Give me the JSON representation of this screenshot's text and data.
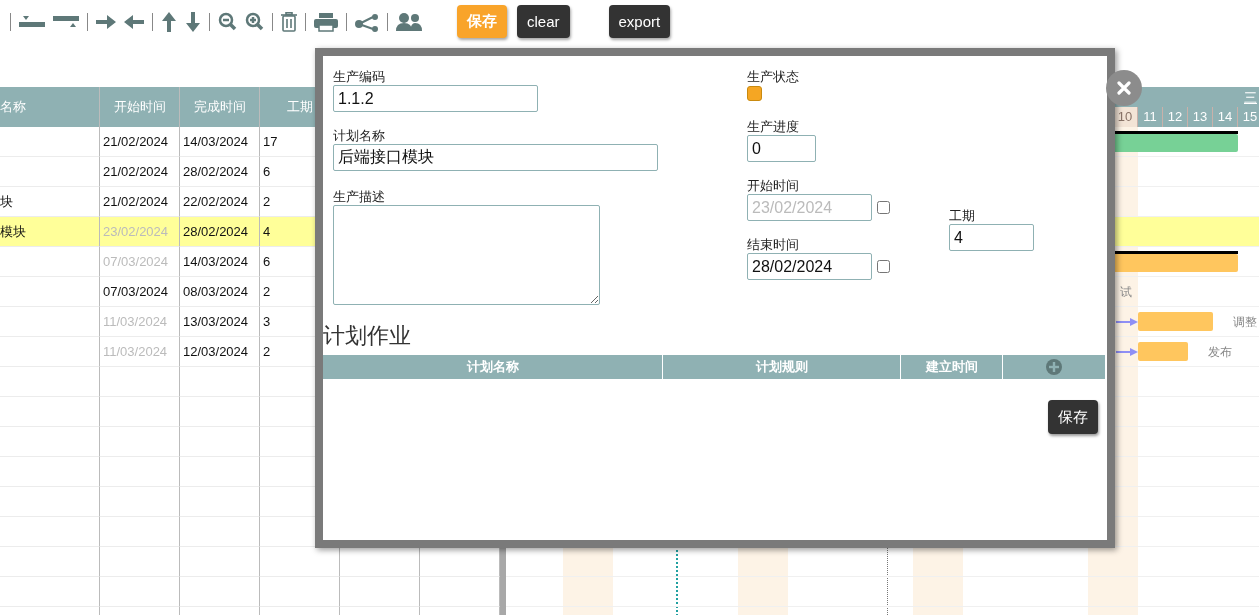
{
  "toolbar": {
    "buttons": [
      {
        "label": "保存",
        "kind": "primary"
      },
      {
        "label": "clear",
        "kind": "dark"
      },
      {
        "label": "export",
        "kind": "dark"
      }
    ]
  },
  "task_table": {
    "columns": [
      "名称",
      "开始时间",
      "完成时间",
      "工期"
    ],
    "rows": [
      {
        "start": "21/02/2024",
        "end": "14/03/2024",
        "duration": "17",
        "start_disabled": false,
        "selected": false,
        "bar": {
          "kind": "summary",
          "color": "#77d196"
        }
      },
      {
        "start": "21/02/2024",
        "end": "28/02/2024",
        "duration": "6",
        "start_disabled": false,
        "selected": false
      },
      {
        "name": "块",
        "start": "21/02/2024",
        "end": "22/02/2024",
        "duration": "2",
        "start_disabled": false,
        "selected": false
      },
      {
        "name": "模块",
        "start": "23/02/2024",
        "end": "28/02/2024",
        "duration": "4",
        "start_disabled": true,
        "selected": true
      },
      {
        "start": "07/03/2024",
        "end": "14/03/2024",
        "duration": "6",
        "start_disabled": true,
        "selected": false,
        "bar": {
          "kind": "summary",
          "color": "#ffc65e"
        }
      },
      {
        "start": "07/03/2024",
        "end": "08/03/2024",
        "duration": "2",
        "start_disabled": false,
        "selected": false,
        "bar_label": "试"
      },
      {
        "start": "11/03/2024",
        "end": "13/03/2024",
        "duration": "3",
        "start_disabled": true,
        "selected": false,
        "bar": {
          "kind": "task",
          "color": "#ffc65e",
          "dependency": true
        },
        "bar_label": "调整"
      },
      {
        "start": "11/03/2024",
        "end": "12/03/2024",
        "duration": "2",
        "start_disabled": true,
        "selected": false,
        "bar": {
          "kind": "task",
          "color": "#ffc65e",
          "dependency": true
        },
        "bar_label": "发布"
      }
    ]
  },
  "gantt": {
    "month": "三",
    "days": [
      "10",
      "11",
      "12",
      "13",
      "14",
      "15"
    ]
  },
  "dialog": {
    "code": {
      "label": "生产编码",
      "value": "1.1.2"
    },
    "name": {
      "label": "计划名称",
      "value": "后端接口模块"
    },
    "description": {
      "label": "生产描述"
    },
    "status": {
      "label": "生产状态",
      "color": "#f5a623"
    },
    "progress": {
      "label": "生产进度",
      "value": "0"
    },
    "start": {
      "label": "开始时间",
      "value": "23/02/2024",
      "disabled": true,
      "checked": false
    },
    "end": {
      "label": "结束时间",
      "value": "28/02/2024",
      "disabled": false,
      "checked": false
    },
    "duration": {
      "label": "工期",
      "value": "4"
    },
    "section_title": "计划作业",
    "jobs_table": {
      "columns": [
        "计划名称",
        "计划规则",
        "建立时间"
      ]
    },
    "save_button": "保存"
  }
}
